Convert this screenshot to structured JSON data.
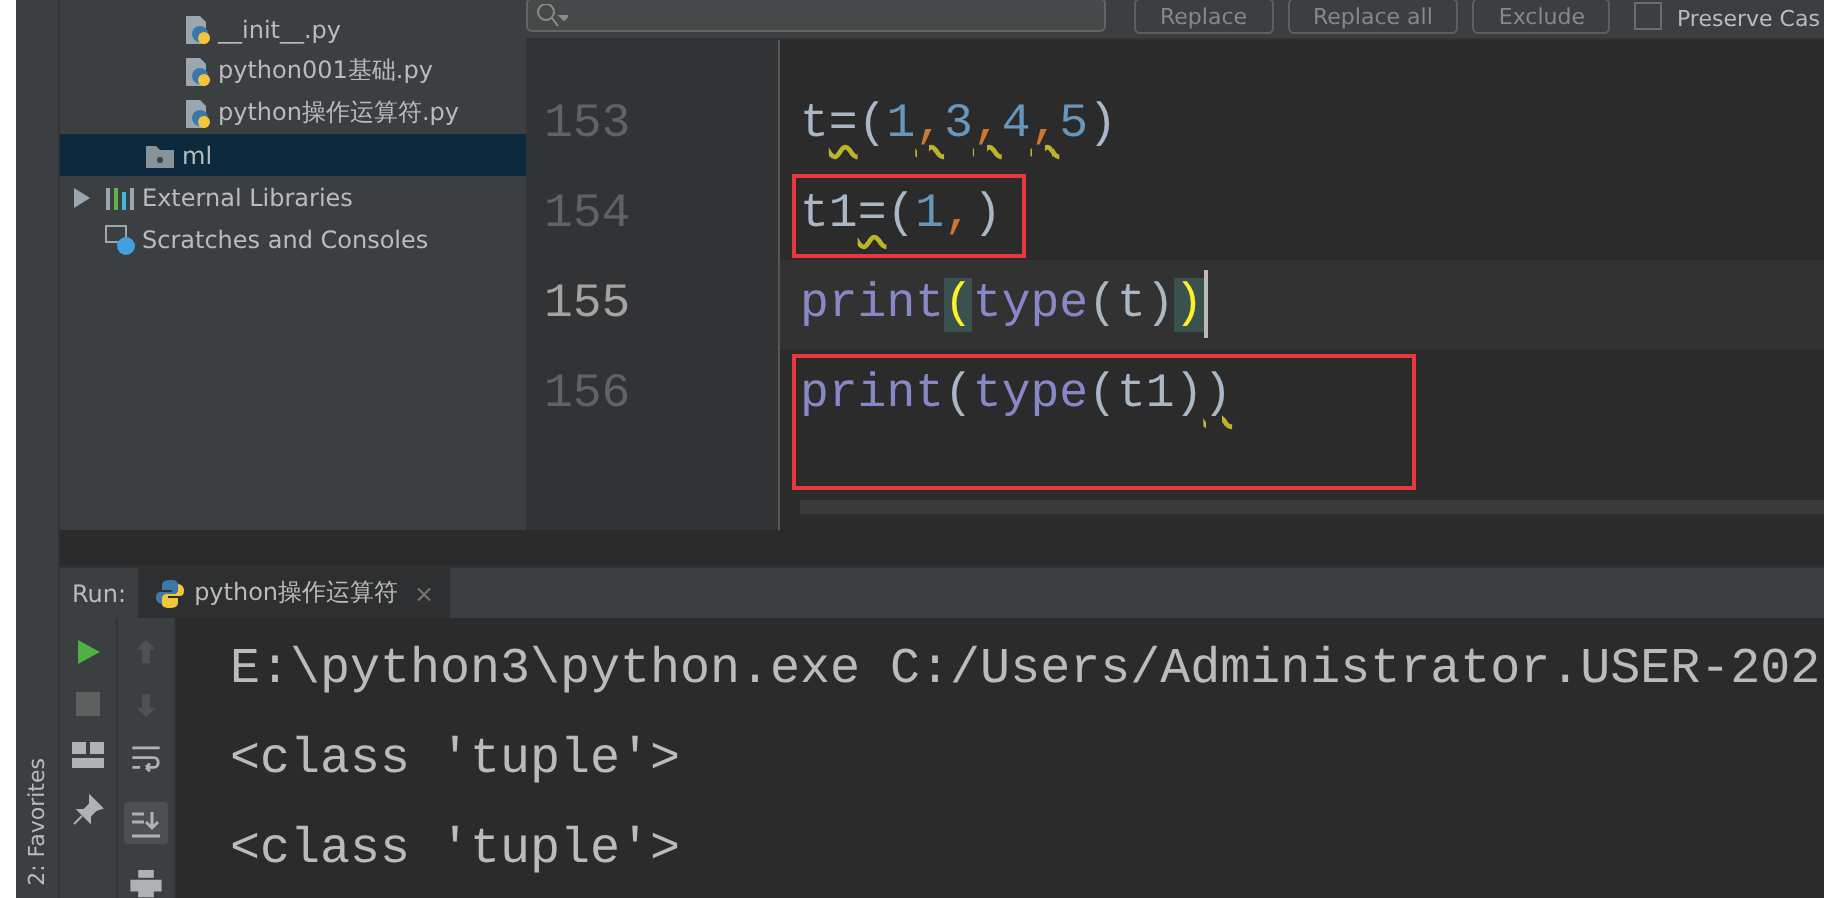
{
  "find_bar": {
    "buttons": [
      "Replace",
      "Replace all",
      "Exclude"
    ],
    "preserve_case": {
      "label": "Preserve Cas",
      "checked": false
    }
  },
  "project_tree": [
    {
      "children": [
        {
          "children": [
            {
              "label": "__init__.py",
              "kind": "pyfile",
              "selected": false
            },
            {
              "label": "python001基础.py",
              "kind": "pyfile",
              "selected": false
            },
            {
              "label": "python操作运算符.py",
              "kind": "pyfile",
              "selected": false
            }
          ]
        },
        {
          "label": "ml",
          "kind": "folder",
          "selected": true
        }
      ]
    },
    {
      "label": "External Libraries",
      "kind": "libraries",
      "selected": false,
      "expanded": false
    },
    {
      "label": "Scratches and Consoles",
      "kind": "scratches",
      "selected": false
    }
  ],
  "editor": {
    "lines": [
      {
        "number": "153",
        "current": false,
        "boxed": false,
        "tokens": [
          {
            "text": "t",
            "kind": "name",
            "warn": false,
            "matched": false
          },
          {
            "text": "=",
            "kind": "op",
            "warn": true,
            "matched": false
          },
          {
            "text": "(",
            "kind": "paren",
            "warn": false,
            "matched": false
          },
          {
            "text": "1",
            "kind": "number",
            "warn": false,
            "matched": false
          },
          {
            "text": ",",
            "kind": "comma",
            "warn": true,
            "matched": false
          },
          {
            "text": "3",
            "kind": "number",
            "warn": false,
            "matched": false
          },
          {
            "text": ",",
            "kind": "comma",
            "warn": true,
            "matched": false
          },
          {
            "text": "4",
            "kind": "number",
            "warn": false,
            "matched": false
          },
          {
            "text": ",",
            "kind": "comma",
            "warn": true,
            "matched": false
          },
          {
            "text": "5",
            "kind": "number",
            "warn": false,
            "matched": false
          },
          {
            "text": ")",
            "kind": "paren",
            "warn": false,
            "matched": false
          }
        ]
      },
      {
        "number": "154",
        "current": false,
        "boxed": true,
        "tokens": [
          {
            "text": "t1",
            "kind": "name",
            "warn": false,
            "matched": false
          },
          {
            "text": "=",
            "kind": "op",
            "warn": true,
            "matched": false
          },
          {
            "text": "(",
            "kind": "paren",
            "warn": false,
            "matched": false
          },
          {
            "text": "1",
            "kind": "number",
            "warn": false,
            "matched": false
          },
          {
            "text": ",",
            "kind": "comma",
            "warn": false,
            "matched": false
          },
          {
            "text": ")",
            "kind": "paren",
            "warn": false,
            "matched": false
          }
        ]
      },
      {
        "number": "155",
        "current": true,
        "boxed": false,
        "tokens": [
          {
            "text": "print",
            "kind": "builtin",
            "warn": false,
            "matched": false
          },
          {
            "text": "(",
            "kind": "paren",
            "warn": false,
            "matched": true
          },
          {
            "text": "type",
            "kind": "builtin",
            "warn": false,
            "matched": false
          },
          {
            "text": "(",
            "kind": "paren",
            "warn": false,
            "matched": false
          },
          {
            "text": "t",
            "kind": "name",
            "warn": false,
            "matched": false
          },
          {
            "text": ")",
            "kind": "paren",
            "warn": false,
            "matched": false
          },
          {
            "text": ")",
            "kind": "paren",
            "warn": false,
            "matched": true
          }
        ]
      },
      {
        "number": "156",
        "current": false,
        "boxed": true,
        "tokens": [
          {
            "text": "print",
            "kind": "builtin",
            "warn": false,
            "matched": false
          },
          {
            "text": "(",
            "kind": "paren",
            "warn": false,
            "matched": false
          },
          {
            "text": "type",
            "kind": "builtin",
            "warn": false,
            "matched": false
          },
          {
            "text": "(",
            "kind": "paren",
            "warn": false,
            "matched": false
          },
          {
            "text": "t1",
            "kind": "name",
            "warn": false,
            "matched": false
          },
          {
            "text": ")",
            "kind": "paren",
            "warn": false,
            "matched": false
          },
          {
            "text": ")",
            "kind": "paren",
            "warn": true,
            "matched": false
          }
        ]
      }
    ]
  },
  "run_panel": {
    "label": "Run:",
    "tab": {
      "title": "python操作运算符",
      "selected": true,
      "close": "×"
    },
    "output": [
      "E:\\python3\\python.exe C:/Users/Administrator.USER-202",
      "<class 'tuple'>",
      "<class 'tuple'>"
    ],
    "scroll_to_end": {
      "on": true
    }
  },
  "side_tab": "2: Favorites"
}
